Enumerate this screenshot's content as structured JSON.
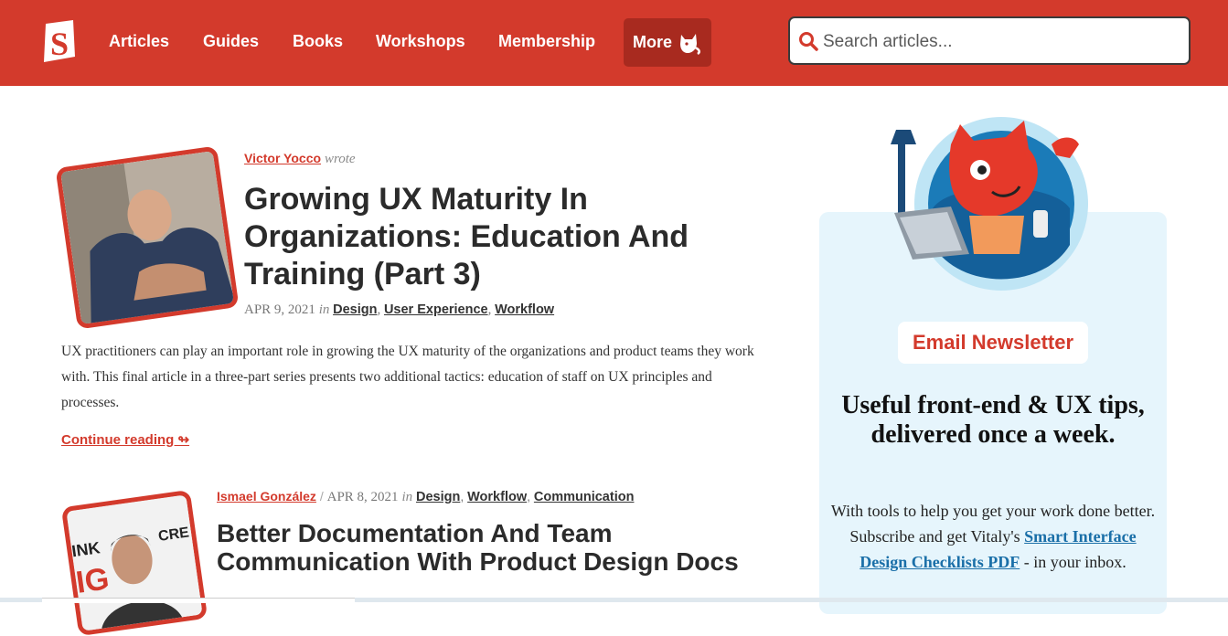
{
  "header": {
    "logo_icon": "smashing-s-logo-icon",
    "nav": [
      "Articles",
      "Guides",
      "Books",
      "Workshops",
      "Membership"
    ],
    "more_label": "More",
    "more_icon": "cat-icon",
    "search_placeholder": "Search articles...",
    "brand_color": "#d33a2c"
  },
  "articles": [
    {
      "author": "Victor Yocco",
      "author_suffix": "wrote",
      "title": "Growing UX Maturity In Organizations: Education And Training (Part 3)",
      "date": "APR 9, 2021",
      "in_label": "in",
      "categories": [
        "Design",
        "User Experience",
        "Workflow"
      ],
      "excerpt": "UX practitioners can play an important role in growing the UX maturity of the organizations and product teams they work with. This final article in a three-part series presents two additional tactics: education of staff on UX principles and processes.",
      "continue_label": "Continue reading ↬"
    },
    {
      "author": "Ismael González",
      "separator": "/",
      "date": "APR 8, 2021",
      "in_label": "in",
      "categories": [
        "Design",
        "Workflow",
        "Communication"
      ],
      "title": "Better Documentation And Team Communication With Product Design Docs"
    }
  ],
  "sidebar": {
    "badge": "Email Newsletter",
    "heading": "Useful front-end & UX tips, delivered once a week.",
    "text_before": "With tools to help you get your work done better. Subscribe and get Vitaly's ",
    "link": "Smart Interface Design Checklists PDF",
    "text_after": " - in your inbox."
  }
}
